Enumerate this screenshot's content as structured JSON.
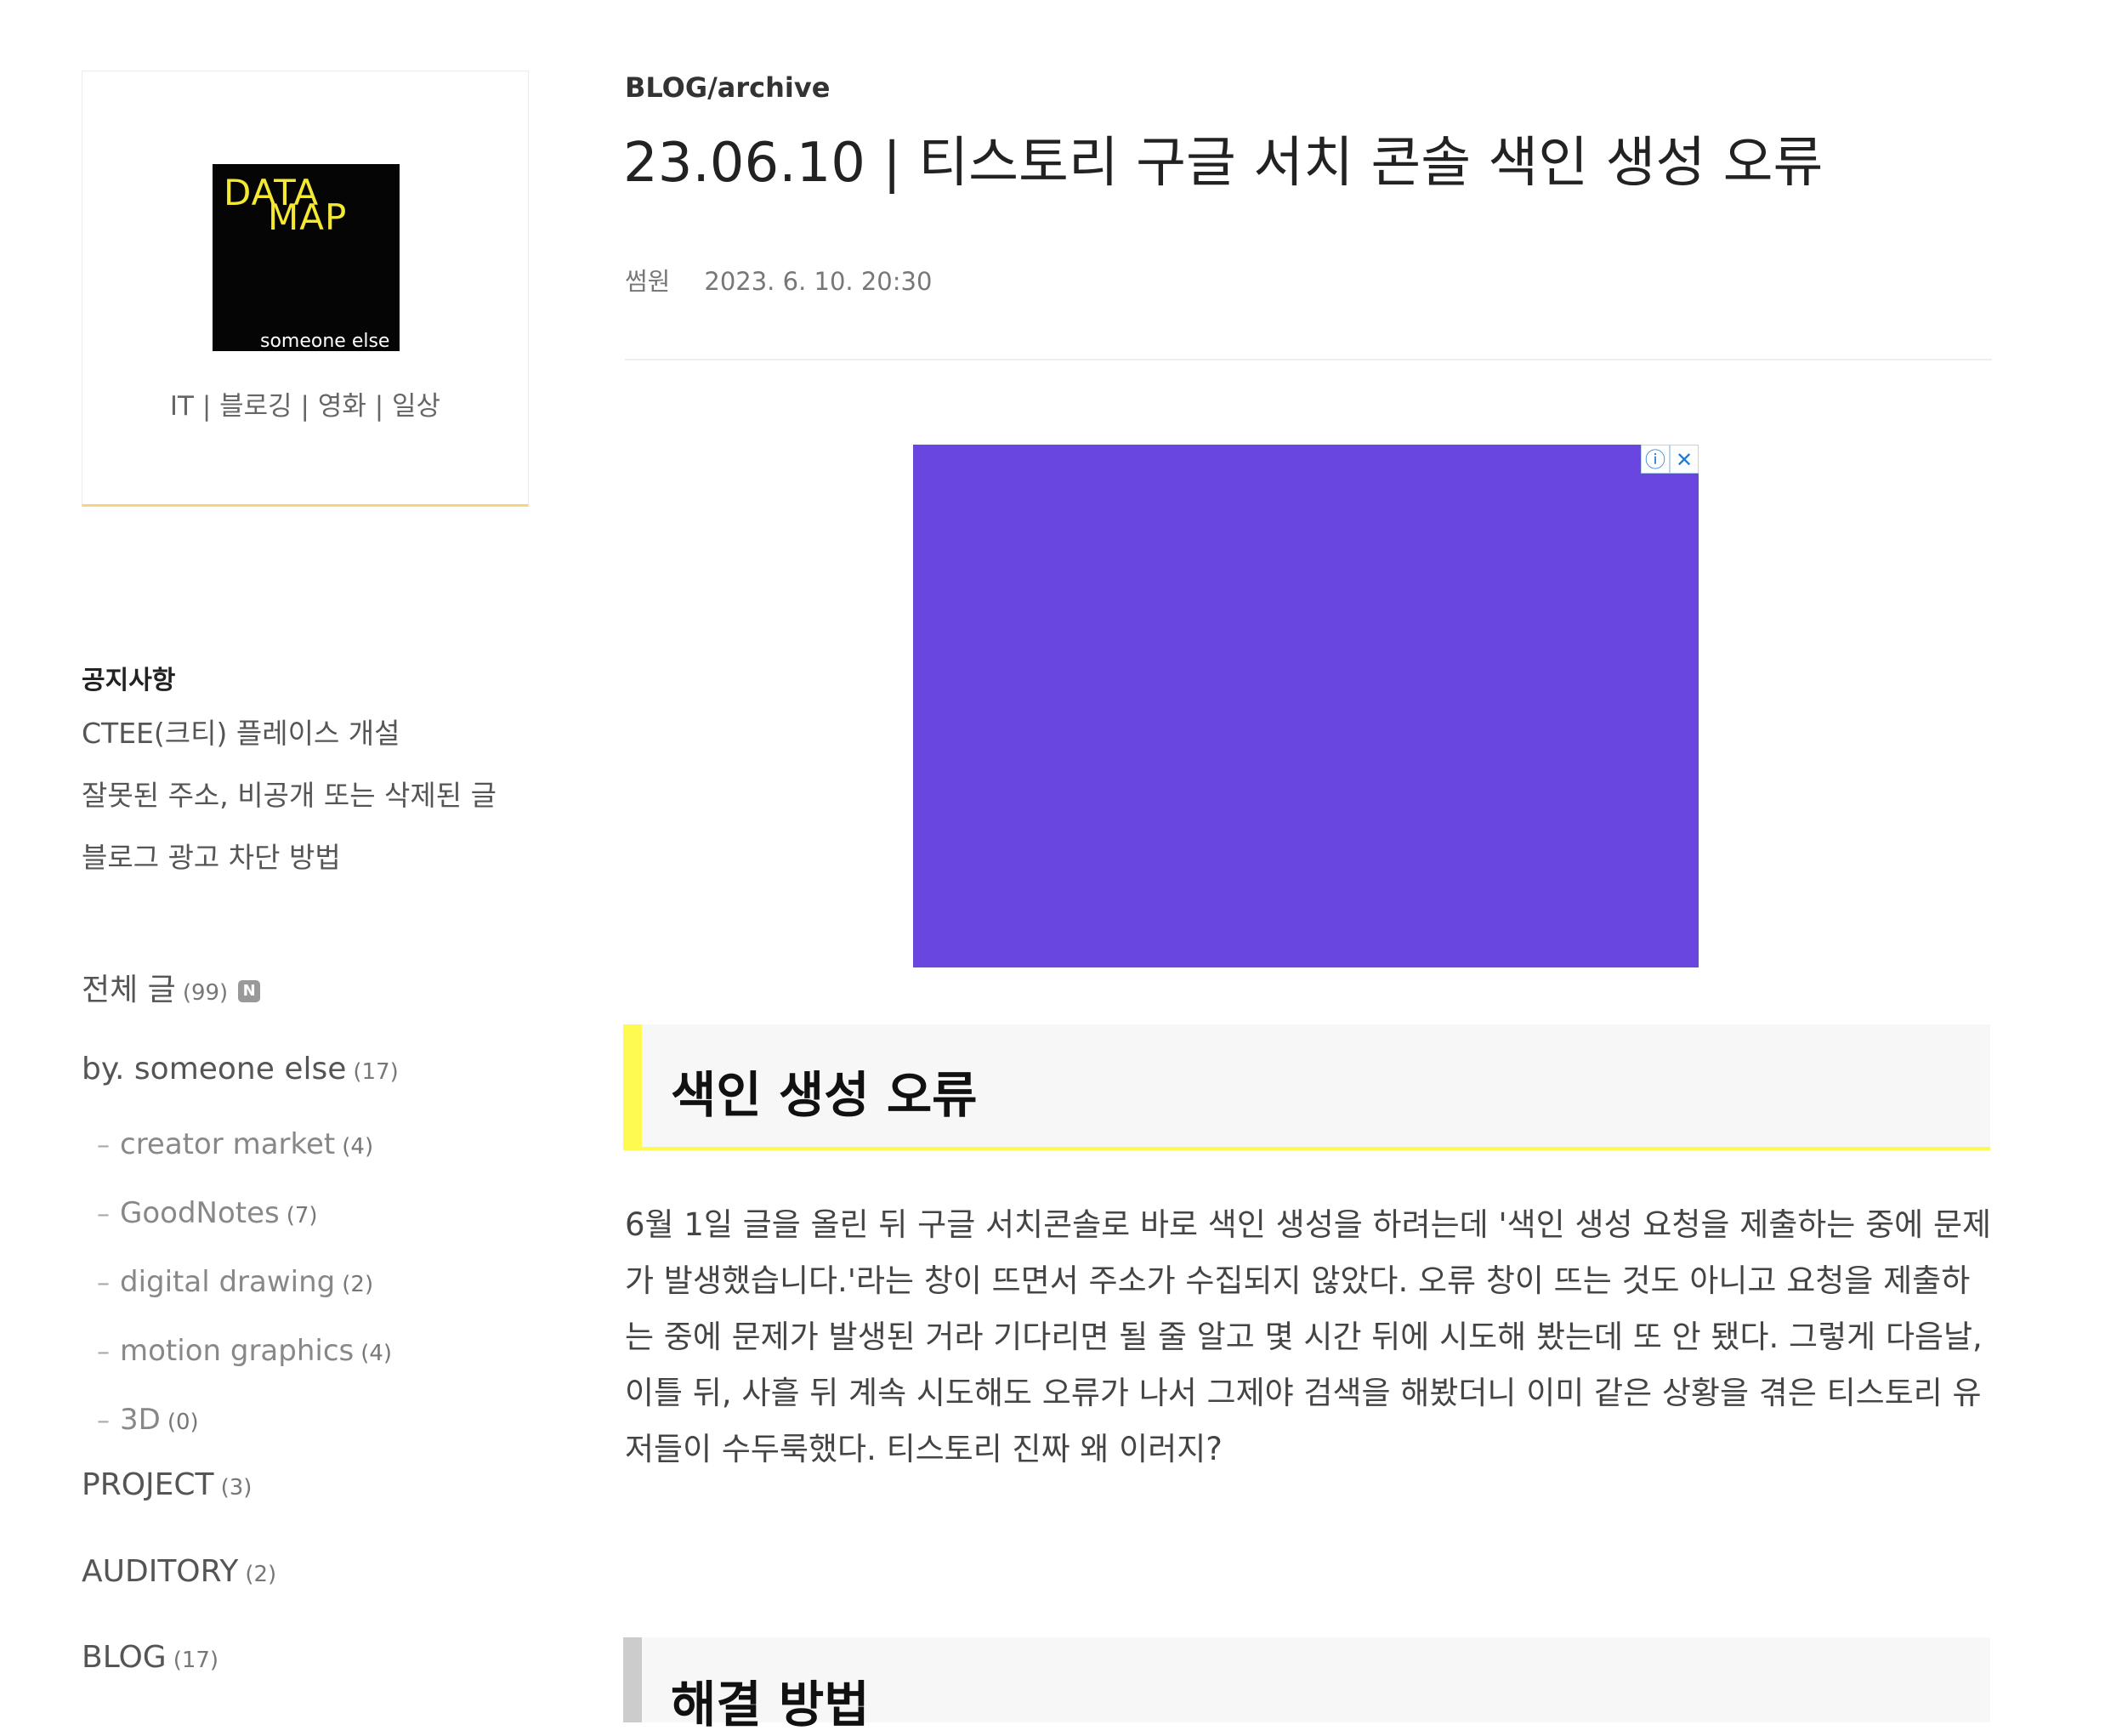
{
  "sidebar": {
    "logo": {
      "line1": "DATA",
      "line2": "MAP",
      "line3": "someone else"
    },
    "tagline": "IT | 블로깅 | 영화 | 일상",
    "notice": {
      "title": "공지사항",
      "items": [
        "CTEE(크티) 플레이스 개설",
        "잘못된 주소, 비공개 또는 삭제된 글",
        "블로그 광고 차단 방법"
      ]
    },
    "categories": {
      "all": {
        "label": "전체 글",
        "count": "(99)",
        "badge": "N"
      },
      "byse": {
        "label": "by. someone else",
        "count": "(17)"
      },
      "subs": [
        {
          "label": "creator market",
          "count": "(4)"
        },
        {
          "label": "GoodNotes",
          "count": "(7)"
        },
        {
          "label": "digital drawing",
          "count": "(2)"
        },
        {
          "label": "motion graphics",
          "count": "(4)"
        },
        {
          "label": "3D",
          "count": "(0)"
        }
      ],
      "project": {
        "label": "PROJECT",
        "count": "(3)"
      },
      "auditory": {
        "label": "AUDITORY",
        "count": "(2)"
      },
      "blog": {
        "label": "BLOG",
        "count": "(17)"
      }
    },
    "sub_dash": "–"
  },
  "post": {
    "category": "BLOG/archive",
    "title": "23.06.10 | 티스토리 구글 서치 콘솔 색인 생성 오류",
    "author": "썸원",
    "date": "2023. 6. 10. 20:30",
    "section1_title": "색인 생성 오류",
    "paragraph": "6월 1일 글을 올린 뒤 구글 서치콘솔로 바로 색인 생성을 하려는데 '색인 생성 요청을 제출하는 중에 문제가 발생했습니다.'라는 창이 뜨면서 주소가 수집되지 않았다. 오류 창이 뜨는 것도 아니고 요청을 제출하는 중에 문제가 발생된 거라 기다리면 될 줄 알고 몇 시간 뒤에 시도해 봤는데 또 안 됐다. 그렇게 다음날, 이틀 뒤, 사흘 뒤 계속 시도해도 오류가 나서 그제야 검색을 해봤더니 이미 같은 상황을 겪은 티스토리 유저들이 수두룩했다. 티스토리 진짜 왜 이러지?",
    "section2_title": "해결 방법"
  },
  "ad": {
    "info_icon": "ⓘ",
    "close_icon": "✕",
    "color": "#6a46e0"
  },
  "colors": {
    "accent_yellow": "#fffa50",
    "card_border": "#f7d57a"
  }
}
